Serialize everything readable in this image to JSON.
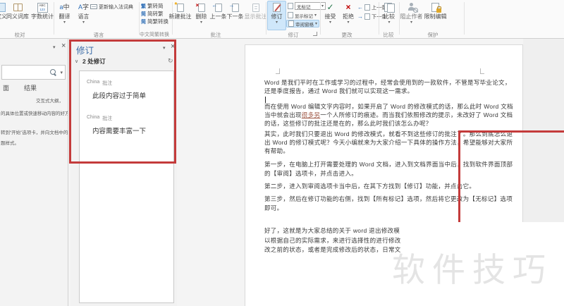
{
  "ribbon": {
    "groups": [
      {
        "label": "校对",
        "items": [
          {
            "label": "定义"
          },
          {
            "label": "同义词库"
          },
          {
            "label": "字数统计"
          }
        ]
      },
      {
        "label": "语言",
        "items": [
          {
            "label": "翻译"
          },
          {
            "label": "语言"
          },
          {
            "label": "更新输入法词典"
          }
        ]
      },
      {
        "label": "中文简繁转换",
        "items": [
          {
            "label": "繁转简"
          },
          {
            "label": "简转繁"
          },
          {
            "label": "简繁转换"
          }
        ]
      },
      {
        "label": "批注",
        "items": [
          {
            "label": "新建批注"
          },
          {
            "label": "删除"
          },
          {
            "label": "上一条"
          },
          {
            "label": "下一条"
          },
          {
            "label": "显示批注"
          }
        ]
      },
      {
        "label": "修订",
        "items": [
          {
            "label": "修订"
          },
          {
            "label": "无标记"
          },
          {
            "label": "显示标记"
          },
          {
            "label": "审阅窗格"
          }
        ]
      },
      {
        "label": "更改",
        "items": [
          {
            "label": "接受"
          },
          {
            "label": "拒绝"
          },
          {
            "label": "上一条"
          },
          {
            "label": "下一条"
          }
        ]
      },
      {
        "label": "比较",
        "items": [
          {
            "label": "比较"
          }
        ]
      },
      {
        "label": "保护",
        "items": [
          {
            "label": "阻止作者"
          },
          {
            "label": "限制编辑"
          }
        ]
      }
    ]
  },
  "icons": {
    "dropdown": "▾",
    "close": "×",
    "chevron": "∨",
    "refresh": "↻",
    "prev": "←",
    "next": "→",
    "check": "✓",
    "cross": "×",
    "star": "*",
    "abc": "ABC",
    "num": "123",
    "translate_a": "a",
    "translate_zh": "中",
    "lang_a": "A",
    "lang_zh": "字",
    "simp": "简",
    "trad": "繁"
  },
  "nav_pane": {
    "tabs": [
      {
        "label": "面"
      },
      {
        "label": "结果"
      }
    ],
    "lines": [
      "交互式大纲，",
      "的具体位置或快速移动内容的好方",
      "转到“开始”选项卡，并向文档中的",
      "题样式。"
    ]
  },
  "revisions_pane": {
    "title": "修订",
    "summary": "2 处修订",
    "comments": [
      {
        "author": "China",
        "tag": "批注",
        "text": "此段内容过于简单"
      },
      {
        "author": "China",
        "tag": "批注",
        "text": "内容需要丰富一下"
      }
    ]
  },
  "document": {
    "p1_l1": "Word 是我们平时在工作或学习的过程中，经常会使用到的一款软件，不管是写毕业论文，",
    "p1_l2": "还是季度报告，通过 Word 我们就可以实现这一需求。",
    "p2_l1": "而在使用 Word 编辑文字内容时，如果开启了 Word 的修改模式的话，那么此时 Word 文档",
    "p2_l2_pre": "当中就会出现",
    "p2_l2_ins": "很多另",
    "p2_l2_post": "一个人所修订的痕迹。而当我们依照修改的提示，未改好了 Word 文档",
    "p2_l3": "的话，这些修订的批注还是在的，那么此时我们该怎么办呢？",
    "p3_l1": "其实，此时我们只要退出 Word 的修改模式，就看不到这些修订的批注了。那么到底怎么退",
    "p3_l2": "出 Word 的修订模式呢？今天小编就来为大家介绍一下具体的操作方法，希望能够对大家所",
    "p3_l3": "有帮助。",
    "p4_l1": "第一步，在电脑上打开需要处理的 Word 文档，进入到文档界面当中后，找到软件界面顶部",
    "p4_l2": "的【审阅】选项卡，并点击进入。",
    "p5_l1": "第二步，进入到审阅选项卡当中后，在其下方找到【修订】功能，并点击它。",
    "p6_l1": "第三步，然后在修订功能的右侧，找到【所有标记】选项，然后将它更改为【无标记】选项",
    "p6_l2": "即可。",
    "p7_l1": "好了，这就是为大家总结的关于 word 退出修改模",
    "p7_l2": "以根据自己的实际需求，来进行选择性的进行修改",
    "p7_l3": "改之前的状态，或者是完成修改后的状态，日常文"
  },
  "watermark": "软件技巧",
  "colors": {
    "annotation_red": "#c43b3b",
    "pane_title_blue": "#3b6ca8",
    "highlight_blue": "#cfe7fa",
    "insert_red": "#9c5340"
  }
}
